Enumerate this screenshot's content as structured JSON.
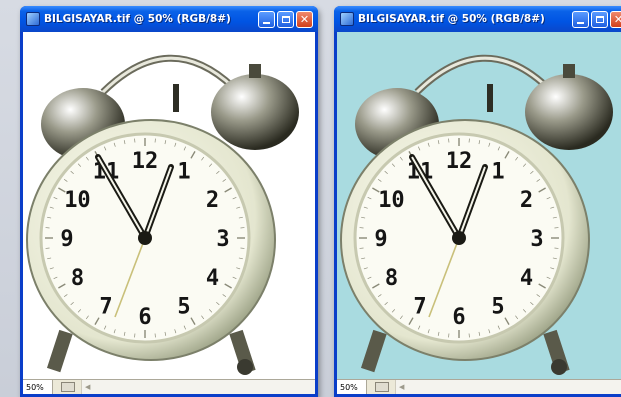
{
  "windows": [
    {
      "title": "BILGISAYAR.tif @ 50% (RGB/8#)",
      "zoom": "50%",
      "background_color": "#ffffff",
      "clock_numerals": [
        "12",
        "1",
        "2",
        "3",
        "4",
        "5",
        "6",
        "7",
        "8",
        "9",
        "10",
        "11"
      ]
    },
    {
      "title": "BILGISAYAR.tif @ 50% (RGB/8#)",
      "zoom": "50%",
      "background_color": "#a9dbe0",
      "clock_numerals": [
        "12",
        "1",
        "2",
        "3",
        "4",
        "5",
        "6",
        "7",
        "8",
        "9",
        "10",
        "11"
      ]
    }
  ],
  "title_buttons": {
    "close": "✕"
  },
  "icons": [
    "photoshop-doc-icon",
    "minimize-icon",
    "maximize-icon",
    "close-icon",
    "alarm-clock-image",
    "navigator-icon"
  ]
}
